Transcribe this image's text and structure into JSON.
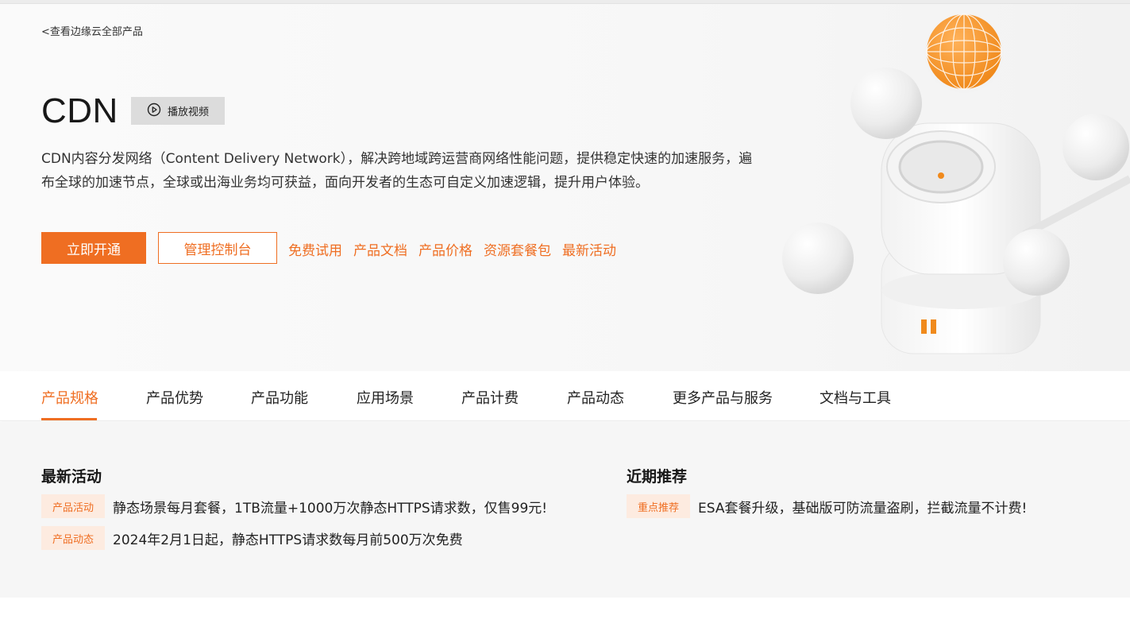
{
  "header": {
    "back_link": "<查看边缘云全部产品",
    "title": "CDN",
    "video_button": "播放视频",
    "description": "CDN内容分发网络（Content Delivery Network），解决跨地域跨运营商网络性能问题，提供稳定快速的加速服务，遍布全球的加速节点，全球或出海业务均可获益，面向开发者的生态可自定义加速逻辑，提升用户体验。"
  },
  "actions": {
    "primary": "立即开通",
    "secondary": "管理控制台",
    "links": [
      "免费试用",
      "产品文档",
      "产品价格",
      "资源套餐包",
      "最新活动"
    ]
  },
  "tabs": [
    "产品规格",
    "产品优势",
    "产品功能",
    "应用场景",
    "产品计费",
    "产品动态",
    "更多产品与服务",
    "文档与工具"
  ],
  "active_tab": "产品规格",
  "news": {
    "left": {
      "title": "最新活动",
      "items": [
        {
          "tag": "产品活动",
          "text": "静态场景每月套餐，1TB流量+1000万次静态HTTPS请求数，仅售99元!"
        },
        {
          "tag": "产品动态",
          "text": "2024年2月1日起，静态HTTPS请求数每月前500万次免费"
        }
      ]
    },
    "right": {
      "title": "近期推荐",
      "items": [
        {
          "tag": "重点推荐",
          "text": "ESA套餐升级，基础版可防流量盗刷，拦截流量不计费!"
        }
      ]
    }
  },
  "colors": {
    "accent": "#ef6e22",
    "tag_bg": "#fdebe0",
    "news_bg": "#f6f6f6"
  }
}
